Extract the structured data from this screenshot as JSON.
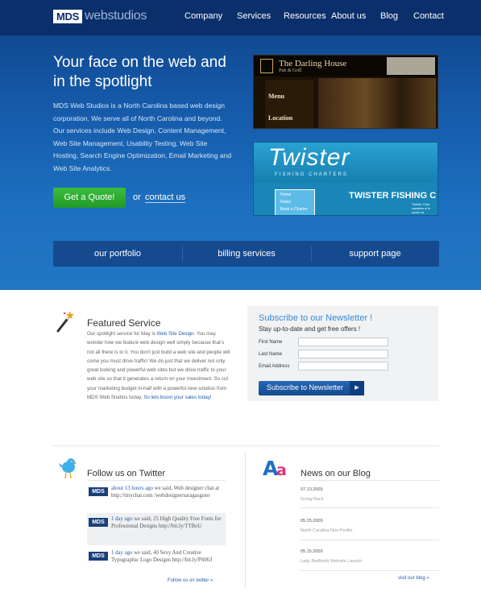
{
  "brand": {
    "logo_box": "MDS",
    "logo_text": "webstudios"
  },
  "nav": [
    "Company",
    "Services",
    "Resources",
    "About us",
    "Blog",
    "Contact"
  ],
  "hero": {
    "title": "Your face on the web and in the spotlight",
    "text": "MDS Web Studios is a North Carolina based web design corporation. We serve all of North Carolina and beyond. Our services include Web Design, Content Management, Web Site Management, Usability Testing, Web Site Hosting, Search Engine Optimization, Email Marketing and Web Site Analytics.",
    "quote_button": "Get a Quote!",
    "or": "or",
    "contact_link": "contact us"
  },
  "shots": {
    "darling": {
      "title": "The Darling House",
      "subtitle": "Pub & Grill",
      "menu": "Menu",
      "location": "Location"
    },
    "twister": {
      "title": "Twister",
      "subtitle": "FISHING CHARTERS",
      "heading": "TWISTER FISHING C",
      "links": [
        "Home",
        "Rates",
        "Book a Charter"
      ],
      "small": "Twister Char captains w in south ca"
    }
  },
  "tabs": [
    "our portfolio",
    "billing services",
    "support page"
  ],
  "featured": {
    "title": "Featured Service",
    "text_before": "Our spotlight service for May is ",
    "highlight": "Web Site Design",
    "text_middle": ". You may wonder how we feature web design well simply because that's not all there is to it. You don't just build a web site and people will come you must drive traffic! We do just that we deliver not only great looking and powerful web sites but we drive traffic to your web site so that it generates a return on your investment. So cut your marketing budget in-half with a powerful new solution from MDS Web Studios today. ",
    "link": "So lets boost your sales today!"
  },
  "newsletter": {
    "title": "Subscribe to our Newsletter !",
    "subtitle": "Stay up-to-date and get free offers !",
    "fields": [
      "First Name",
      "Last Name",
      "Email Address"
    ],
    "button": "Subscribe to Newsletter",
    "button_arrow": "▶"
  },
  "twitter": {
    "title": "Follow us on Twitter",
    "tweets": [
      {
        "logo": "MDS",
        "time": "about 13 hours ago",
        "said": " we said, Web designer chat at http://tinychat.com /webdesignersaragasgster"
      },
      {
        "logo": "MDS",
        "time": "1 day ago",
        "said": " we said, 25 High Quality Free Fonts for Professional Designs http://bit.ly/TTBoU"
      },
      {
        "logo": "MDS",
        "time": "1 day ago",
        "said": " we said, 40 Sexy And Creative Typographic Logo Designs http://bit.ly/P6063"
      }
    ],
    "more": "Follow us on twitter  »"
  },
  "blog": {
    "title": "News on our Blog",
    "posts": [
      {
        "date": "07.13.2009",
        "title": "Going Back"
      },
      {
        "date": "05.25.2009",
        "title": "North Carolina Non-Profits"
      },
      {
        "date": "05.15.2009",
        "title": "Lady Bedfords Website Launch"
      }
    ],
    "more": "visit our blog  »"
  },
  "colors": {
    "brand_dark": "#0a2f6a",
    "hero_blue": "#1c6fbf",
    "accent_link": "#1f5fb0",
    "cta_green": "#2aa82e",
    "newsletter_title": "#3b8ad6"
  }
}
